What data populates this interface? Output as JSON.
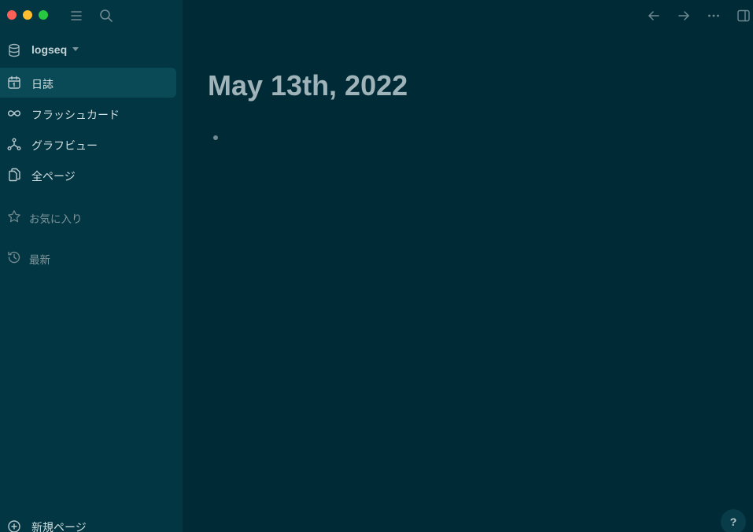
{
  "window": {
    "controls": [
      "close",
      "minimize",
      "zoom"
    ]
  },
  "toolbar": {
    "left_icons": [
      "menu-icon",
      "search-icon"
    ],
    "right_icons": [
      "back-arrow-icon",
      "forward-arrow-icon",
      "more-icon",
      "right-sidebar-icon"
    ]
  },
  "sidebar": {
    "graph": {
      "name": "logseq",
      "icon": "database-icon"
    },
    "nav": [
      {
        "label": "日誌",
        "icon": "calendar-icon",
        "active": true
      },
      {
        "label": "フラッシュカード",
        "icon": "infinity-icon",
        "active": false
      },
      {
        "label": "グラフビュー",
        "icon": "graph-icon",
        "active": false
      },
      {
        "label": "全ページ",
        "icon": "pages-icon",
        "active": false
      }
    ],
    "favorites": {
      "label": "お気に入り",
      "icon": "star-icon"
    },
    "recent": {
      "label": "最新",
      "icon": "history-icon"
    },
    "new_page": {
      "label": "新規ページ",
      "icon": "plus-circle-icon"
    }
  },
  "main": {
    "title": "May 13th, 2022"
  },
  "help": {
    "label": "?"
  },
  "colors": {
    "sidebar_bg": "#023643",
    "main_bg": "#002b36",
    "active_item_bg": "#0a4a56",
    "title_color": "#9fb3b8"
  }
}
